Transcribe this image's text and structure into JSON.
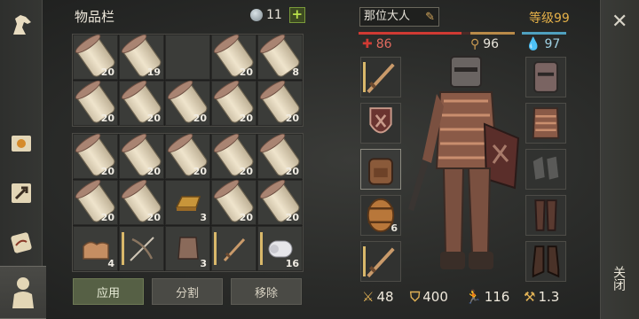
{
  "inventory": {
    "title": "物品栏",
    "slots_free": "11",
    "add_slots_label": "+",
    "grid_top": [
      {
        "icon": "scroll-icon",
        "count": "20"
      },
      {
        "icon": "scroll-icon",
        "count": "19"
      },
      {
        "icon": "",
        "count": ""
      },
      {
        "icon": "scroll-icon",
        "count": "20"
      },
      {
        "icon": "scroll-icon",
        "count": "8"
      },
      {
        "icon": "scroll-icon",
        "count": "20"
      },
      {
        "icon": "scroll-icon",
        "count": "20"
      },
      {
        "icon": "scroll-icon",
        "count": "20"
      },
      {
        "icon": "scroll-icon",
        "count": "20"
      },
      {
        "icon": "scroll-icon",
        "count": "20"
      }
    ],
    "grid_bottom": [
      {
        "icon": "scroll-icon",
        "count": "20"
      },
      {
        "icon": "scroll-icon",
        "count": "20"
      },
      {
        "icon": "scroll-icon",
        "count": "20"
      },
      {
        "icon": "scroll-icon",
        "count": "20"
      },
      {
        "icon": "scroll-icon",
        "count": "20"
      },
      {
        "icon": "scroll-icon",
        "count": "20"
      },
      {
        "icon": "scroll-icon",
        "count": "20"
      },
      {
        "icon": "bronze-ingot-icon",
        "count": "3"
      },
      {
        "icon": "scroll-icon",
        "count": "20"
      },
      {
        "icon": "scroll-icon",
        "count": "20"
      },
      {
        "icon": "cloth-icon",
        "count": "4"
      },
      {
        "icon": "crossbow-icon",
        "count": ""
      },
      {
        "icon": "chest-plate-icon",
        "count": "3"
      },
      {
        "icon": "sword-icon",
        "count": ""
      },
      {
        "icon": "paper-roll-icon",
        "count": "16"
      }
    ],
    "buttons": {
      "apply": "应用",
      "split": "分割",
      "remove": "移除"
    }
  },
  "character": {
    "name": "那位大人",
    "level": "等级99",
    "health": "86",
    "food": "96",
    "water": "97",
    "equip_left": [
      {
        "icon": "sword-icon",
        "count": ""
      },
      {
        "icon": "shield-icon",
        "count": ""
      },
      {
        "icon": "backpack-icon",
        "count": ""
      },
      {
        "icon": "barrel-icon",
        "count": "6"
      },
      {
        "icon": "sword-icon",
        "count": ""
      }
    ],
    "equip_right": [
      {
        "icon": "helmet-icon",
        "count": ""
      },
      {
        "icon": "chest-armor-icon",
        "count": ""
      },
      {
        "icon": "gloves-icon",
        "count": ""
      },
      {
        "icon": "leg-armor-icon",
        "count": ""
      },
      {
        "icon": "boots-icon",
        "count": ""
      }
    ],
    "stats": {
      "attack": "48",
      "armor": "400",
      "speed": "116",
      "damage_mult": "1.3"
    }
  },
  "close_label": "关闭",
  "colors": {
    "health": "#d03a33",
    "food": "#b98a48",
    "water": "#4fa0bf",
    "level": "#e4b048",
    "apply_button": "#566045"
  }
}
